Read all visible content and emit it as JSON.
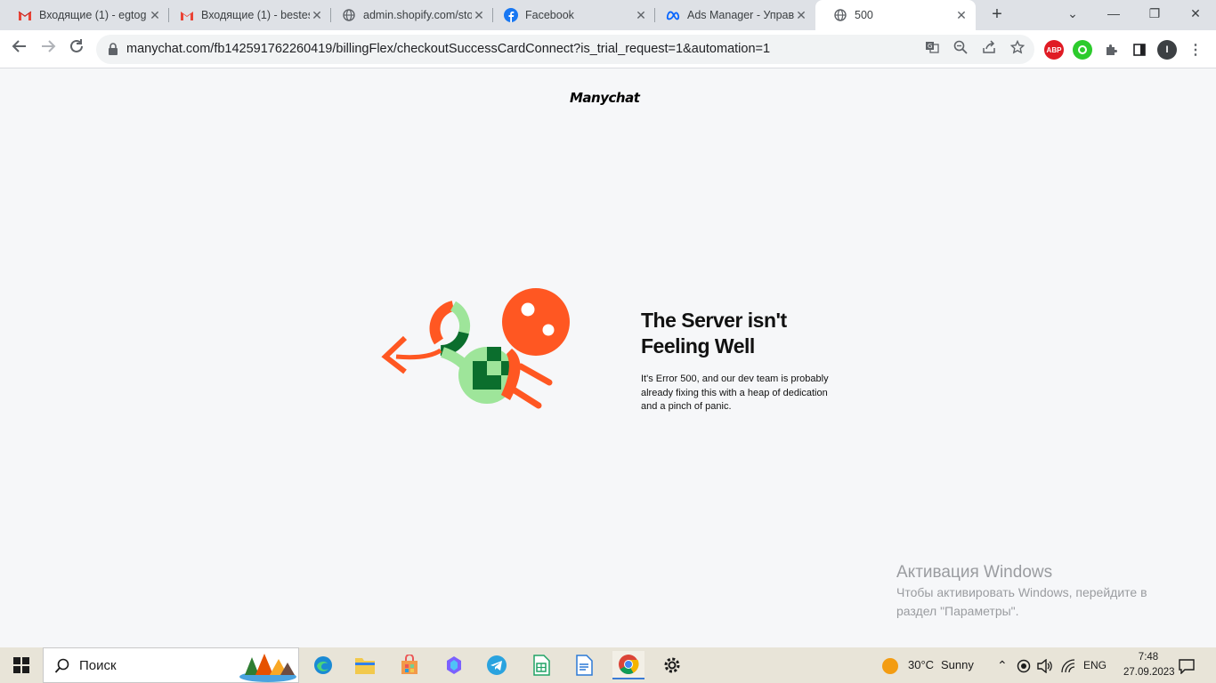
{
  "browser": {
    "tabs": [
      {
        "title": "Входящие (1) - egtog",
        "icon": "gmail-icon"
      },
      {
        "title": "Входящие (1) - bestes",
        "icon": "gmail-icon"
      },
      {
        "title": "admin.shopify.com/sto",
        "icon": "globe-icon"
      },
      {
        "title": "Facebook",
        "icon": "facebook-icon"
      },
      {
        "title": "Ads Manager - Управ",
        "icon": "meta-icon"
      },
      {
        "title": "500",
        "icon": "globe-icon",
        "active": true
      }
    ],
    "new_tab": "+",
    "window_controls": {
      "minimize": "—",
      "maximize": "❐",
      "close": "✕",
      "tab_search": "⌄"
    },
    "url": "manychat.com/fb142591762260419/billingFlex/checkoutSuccessCardConnect?is_trial_request=1&automation=1",
    "profile_initial": "I",
    "extension_abp": "ABP"
  },
  "page": {
    "logo": "Manychat",
    "error_title": "The Server isn't Feeling Well",
    "error_text": "It's Error 500, and our dev team is probably already fixing this with a heap of dedication and a pinch of panic.",
    "colors": {
      "orange": "#ff5722",
      "dark_green": "#0b6e2d",
      "light_green": "#9ee59a"
    }
  },
  "watermark": {
    "line1": "Активация Windows",
    "line2": "Чтобы активировать Windows, перейдите в раздел \"Параметры\"."
  },
  "taskbar": {
    "search_placeholder": "Поиск",
    "weather_temp": "30°C",
    "weather_text": "Sunny",
    "lang": "ENG",
    "time": "7:48",
    "date": "27.09.2023"
  }
}
